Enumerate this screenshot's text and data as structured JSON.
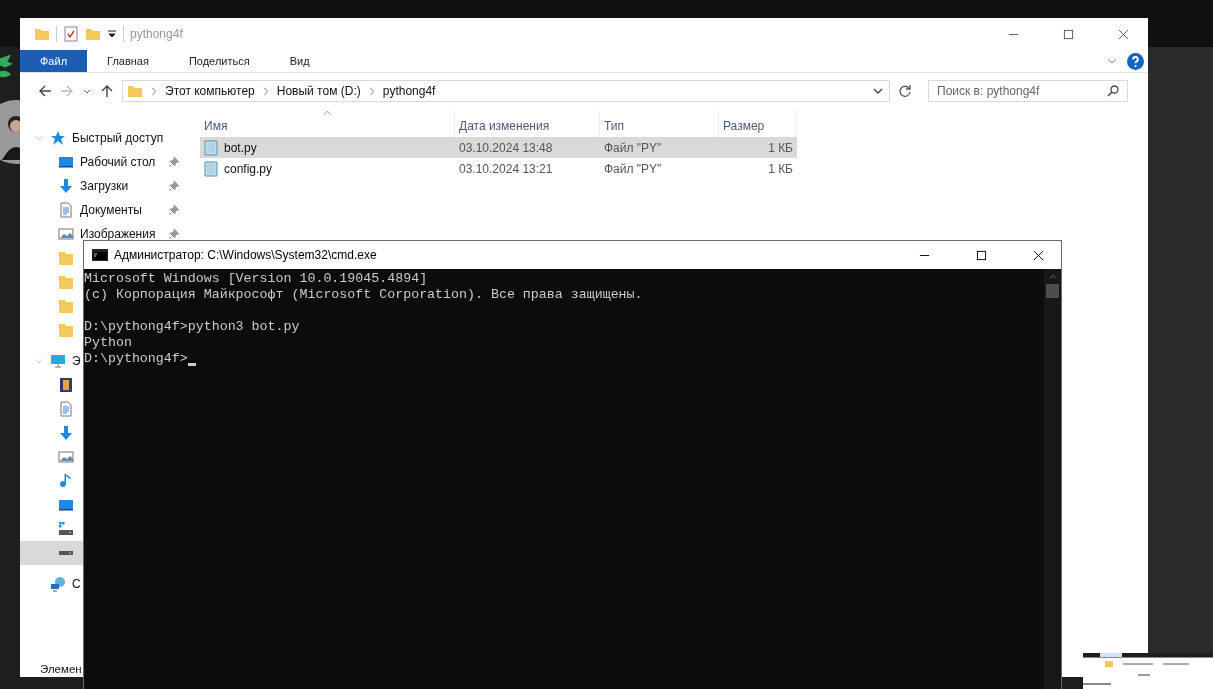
{
  "explorer": {
    "title": "pythong4f",
    "ribbon_tabs": [
      {
        "label": "Файл",
        "selected": true
      },
      {
        "label": "Главная",
        "selected": false
      },
      {
        "label": "Поделиться",
        "selected": false
      },
      {
        "label": "Вид",
        "selected": false
      }
    ],
    "address": {
      "crumbs": [
        "Этот компьютер",
        "Новый том (D:)",
        "pythong4f"
      ]
    },
    "search": {
      "placeholder": "Поиск в: pythong4f"
    },
    "sidebar": [
      {
        "label": "Быстрый доступ",
        "kind": "star",
        "selected": false,
        "children": [
          {
            "label": "Рабочий стол",
            "kind": "desktop",
            "pinned": true,
            "selected": false
          },
          {
            "label": "Загрузки",
            "kind": "download",
            "pinned": true,
            "selected": false
          },
          {
            "label": "Документы",
            "kind": "document",
            "pinned": true,
            "selected": false
          },
          {
            "label": "Изображения",
            "kind": "pictures",
            "pinned": true,
            "selected": false
          },
          {
            "kind": "folder",
            "selected": false
          },
          {
            "kind": "folder",
            "selected": false
          },
          {
            "kind": "folder",
            "selected": false
          },
          {
            "kind": "folder",
            "selected": false
          }
        ]
      },
      {
        "label": "Э",
        "kind": "computer",
        "selected": false,
        "children": [
          {
            "kind": "video",
            "selected": false
          },
          {
            "kind": "document",
            "selected": false
          },
          {
            "kind": "download",
            "selected": false
          },
          {
            "kind": "pictures",
            "selected": false
          },
          {
            "kind": "music",
            "selected": false
          },
          {
            "kind": "desktop",
            "selected": false
          },
          {
            "kind": "windrive",
            "selected": false
          },
          {
            "kind": "drive",
            "selected": true
          }
        ]
      },
      {
        "label": "С",
        "kind": "network",
        "selected": false
      }
    ],
    "columns": [
      {
        "label": "Имя",
        "sorted": true
      },
      {
        "label": "Дата изменения",
        "sorted": false
      },
      {
        "label": "Тип",
        "sorted": false
      },
      {
        "label": "Размер",
        "sorted": false
      }
    ],
    "rows": [
      {
        "name": "bot.py",
        "date": "03.10.2024 13:48",
        "type": "Файл \"PY\"",
        "size": "1 КБ",
        "selected": true
      },
      {
        "name": "config.py",
        "date": "03.10.2024 13:21",
        "type": "Файл \"PY\"",
        "size": "1 КБ",
        "selected": false
      }
    ],
    "status_bar": {
      "text": "Элемен"
    }
  },
  "cmd": {
    "title": "Администратор: C:\\Windows\\System32\\cmd.exe",
    "blocks": [
      {
        "lines": [
          "Microsoft Windows [Version 10.0.19045.4894]",
          "(c) Корпорация Майкрософт (Microsoft Corporation). Все права защищены."
        ]
      },
      {
        "lines": [
          "D:\\pythong4f>python3 bot.py",
          "Python",
          "D:\\pythong4f>"
        ]
      }
    ]
  }
}
